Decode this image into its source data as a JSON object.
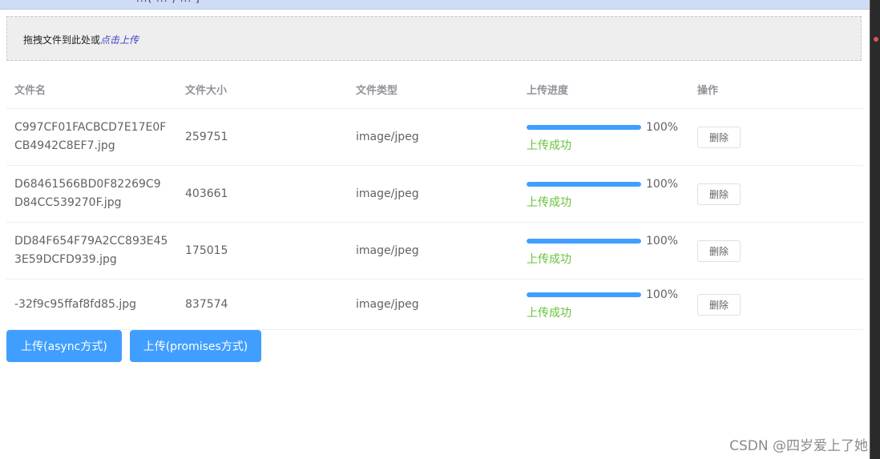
{
  "topbar": {
    "text": "...( ... ) ... ]"
  },
  "upload": {
    "prompt": "拖拽文件到此处或",
    "link": "点击上传"
  },
  "table": {
    "headers": [
      "文件名",
      "文件大小",
      "文件类型",
      "上传进度",
      "操作"
    ],
    "rows": [
      {
        "name": "C997CF01FACBCD7E17E0FCB4942C8EF7.jpg",
        "size": "259751",
        "type": "image/jpeg",
        "progress": 100,
        "progress_label": "100%",
        "status": "上传成功",
        "action": "删除"
      },
      {
        "name": "D68461566BD0F82269C9D84CC539270F.jpg",
        "size": "403661",
        "type": "image/jpeg",
        "progress": 100,
        "progress_label": "100%",
        "status": "上传成功",
        "action": "删除"
      },
      {
        "name": "DD84F654F79A2CC893E453E59DCFD939.jpg",
        "size": "175015",
        "type": "image/jpeg",
        "progress": 100,
        "progress_label": "100%",
        "status": "上传成功",
        "action": "删除"
      },
      {
        "name": "-32f9c95ffaf8fd85.jpg",
        "size": "837574",
        "type": "image/jpeg",
        "progress": 100,
        "progress_label": "100%",
        "status": "上传成功",
        "action": "删除"
      }
    ]
  },
  "buttons": {
    "async": "上传(async方式)",
    "promises": "上传(promises方式)"
  },
  "watermark": "CSDN @四岁爱上了她",
  "colors": {
    "primary": "#409eff",
    "success": "#67c23a",
    "link": "#3d40c9"
  }
}
